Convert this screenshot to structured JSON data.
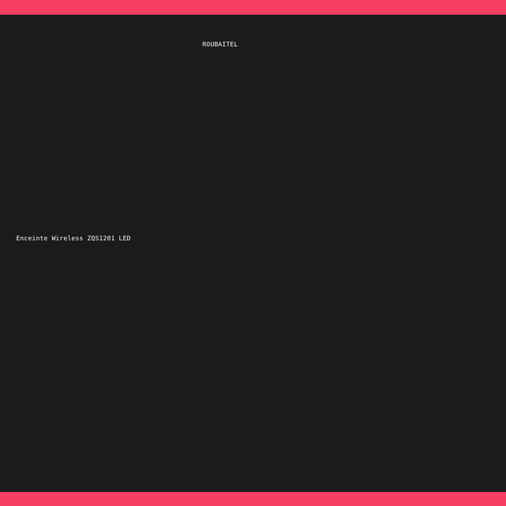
{
  "header": {
    "brand": "ROUBAITEL"
  },
  "main": {
    "product_name": "Enceinte Wireless ZQS1201 LED"
  },
  "colors": {
    "accent": "#f43f62",
    "background": "#1b1b1d",
    "text": "#ffffff"
  }
}
